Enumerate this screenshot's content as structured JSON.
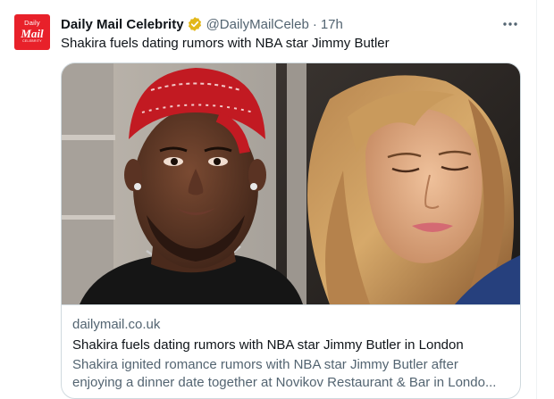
{
  "account": {
    "avatar_line1": "Daily",
    "avatar_line2": "Mail",
    "avatar_line3": "CELEBRITY",
    "display_name": "Daily Mail Celebrity",
    "verified_badge": "gold-verified-badge",
    "handle": "@DailyMailCeleb",
    "separator": "·",
    "timestamp": "17h"
  },
  "tweet": {
    "text": "Shakira fuels dating rumors with NBA star Jimmy Butler"
  },
  "card": {
    "image_icon": "photo",
    "domain": "dailymail.co.uk",
    "title": "Shakira fuels dating rumors with NBA star Jimmy Butler in London",
    "description": "Shakira ignited romance rumors with NBA star Jimmy Butler after enjoying a dinner date together at Novikov Restaurant & Bar in Londo..."
  },
  "colors": {
    "text_primary": "#0f1419",
    "text_secondary": "#536471",
    "border": "#cfd9de",
    "brand_red": "#e8212a",
    "verified_gold": "#e2b719"
  },
  "icons": {
    "more": "more-horizontal-icon"
  }
}
